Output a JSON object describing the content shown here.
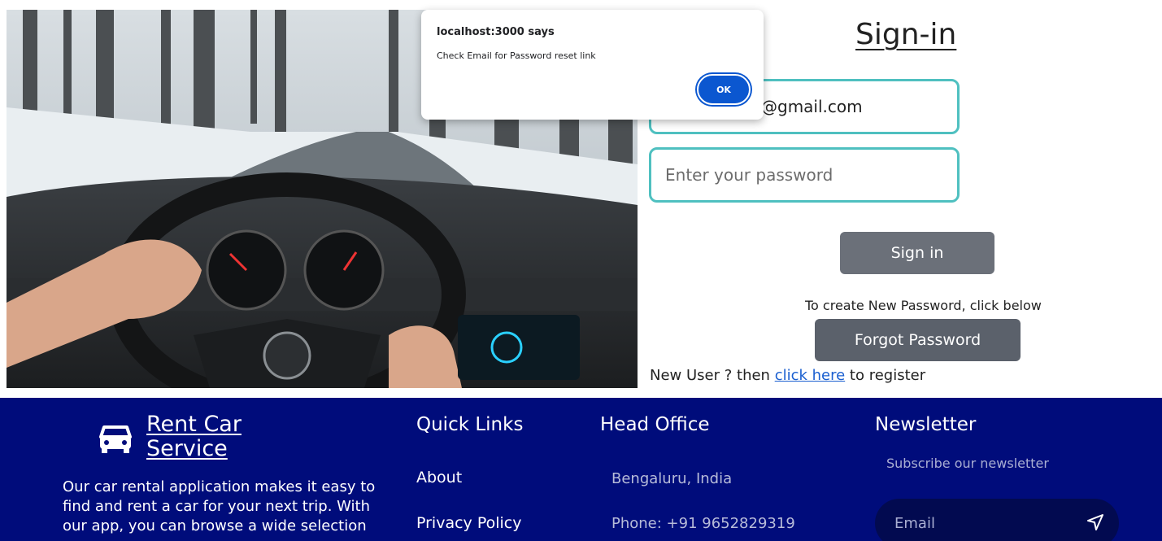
{
  "dialog": {
    "title": "localhost:3000 says",
    "message": "Check Email for Password reset link",
    "ok_label": "OK"
  },
  "signin": {
    "title": "Sign-in",
    "email_value": "@gmail.com",
    "password_placeholder": "Enter your password",
    "signin_button": "Sign in",
    "forgot_hint": "To create New Password, click below",
    "forgot_button": "Forgot Password",
    "register_prefix": "New User ? then ",
    "register_link": "click here",
    "register_suffix": " to register"
  },
  "footer": {
    "brand_line1": "Rent Car",
    "brand_line2": "Service",
    "about": "Our car rental application makes it easy to find and rent a car for your next trip. With our app, you can browse a wide selection",
    "quick_links": {
      "title": "Quick Links",
      "items": [
        "About",
        "Privacy Policy"
      ]
    },
    "head_office": {
      "title": "Head Office",
      "lines": [
        "Bengaluru, India",
        "Phone: +91 9652829319"
      ]
    },
    "newsletter": {
      "title": "Newsletter",
      "subtitle": "Subscribe our newsletter",
      "placeholder": "Email"
    }
  },
  "colors": {
    "footer_bg": "#000c7b",
    "field_border": "#4fc0c0",
    "button_gray": "#6b7079",
    "dialog_ok": "#0b57d0",
    "link": "#1a5fd0"
  },
  "icons": [
    "car-icon",
    "send-icon"
  ]
}
